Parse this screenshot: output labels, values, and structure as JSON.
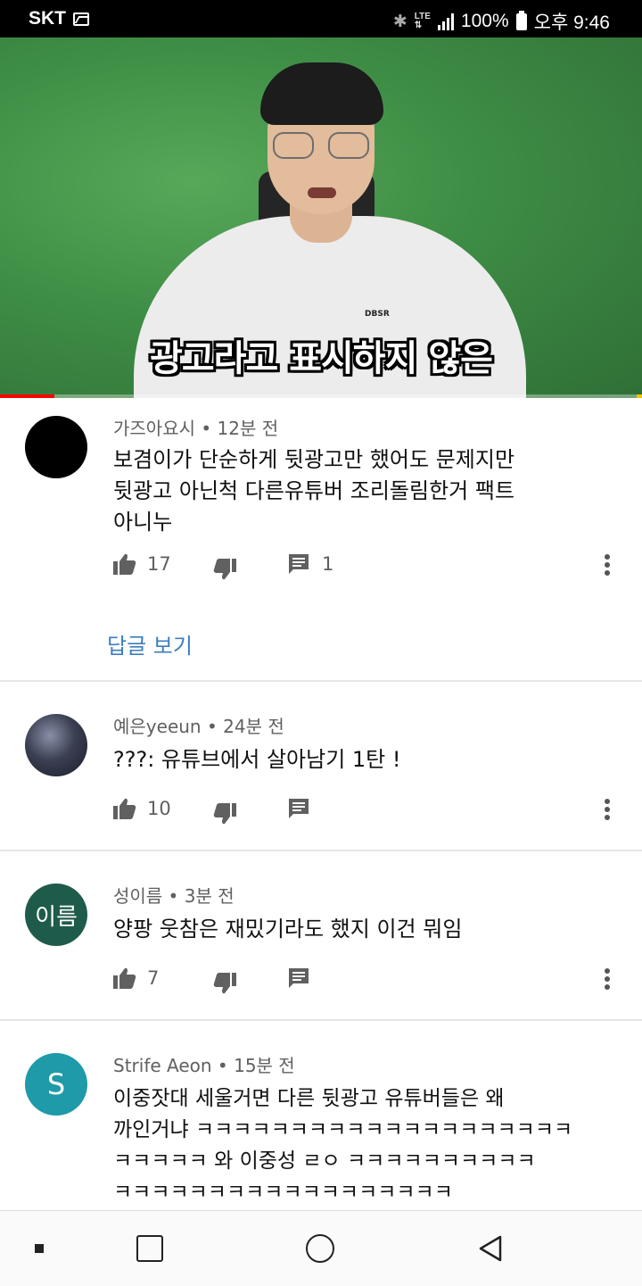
{
  "status_bar": {
    "carrier": "SKT",
    "battery": "100%",
    "time": "오후 9:46"
  },
  "video": {
    "subtitle": "광고라고 표시하지 않은",
    "shirt_logo": "DBSR",
    "progress": 0.085
  },
  "comments": [
    {
      "author": "가즈아요시",
      "time": "12분 전",
      "text": "보겸이가 단순하게 뒷광고만 했어도 문제지만\n뒷광고 아닌척  다른유튜버 조리돌림한거 팩트\n아니누",
      "likes": "17",
      "replies": "1",
      "view_replies": "답글 보기",
      "avatar_color": "#000000"
    },
    {
      "author": "예은yeeun",
      "time": "24분 전",
      "text": "???: 유튜브에서 살아남기 1탄 !",
      "likes": "10",
      "avatar_color": "#2b2f3a"
    },
    {
      "author": "성이름",
      "time": "3분 전",
      "text": "양팡 웃참은 재밌기라도 했지 이건 뭐임",
      "likes": "7",
      "avatar_text": "이름",
      "avatar_color": "#1f5b4a"
    },
    {
      "author": "Strife Aeon",
      "time": "15분 전",
      "text": "이중잣대 세울거면 다른 뒷광고 유튜버들은 왜\n까인거냐 ㅋㅋㅋㅋㅋㅋㅋㅋㅋㅋㅋㅋㅋㅋㅋㅋㅋㅋㅋㅋ\nㅋㅋㅋㅋㅋ 와 이중성 ㄹㅇ ㅋㅋㅋㅋㅋㅋㅋㅋㅋㅋ\nㅋㅋㅋㅋㅋㅋㅋㅋㅋㅋㅋㅋㅋㅋㅋㅋㅋㅋ",
      "avatar_text": "S",
      "avatar_color": "#1e9aa8"
    }
  ],
  "icons": {
    "like": "thumb-up-icon",
    "dislike": "thumb-down-icon",
    "reply": "comment-icon",
    "more": "more-vert-icon"
  },
  "nav": [
    "recent-apps-dot",
    "home-square",
    "home-circle",
    "back-triangle"
  ]
}
